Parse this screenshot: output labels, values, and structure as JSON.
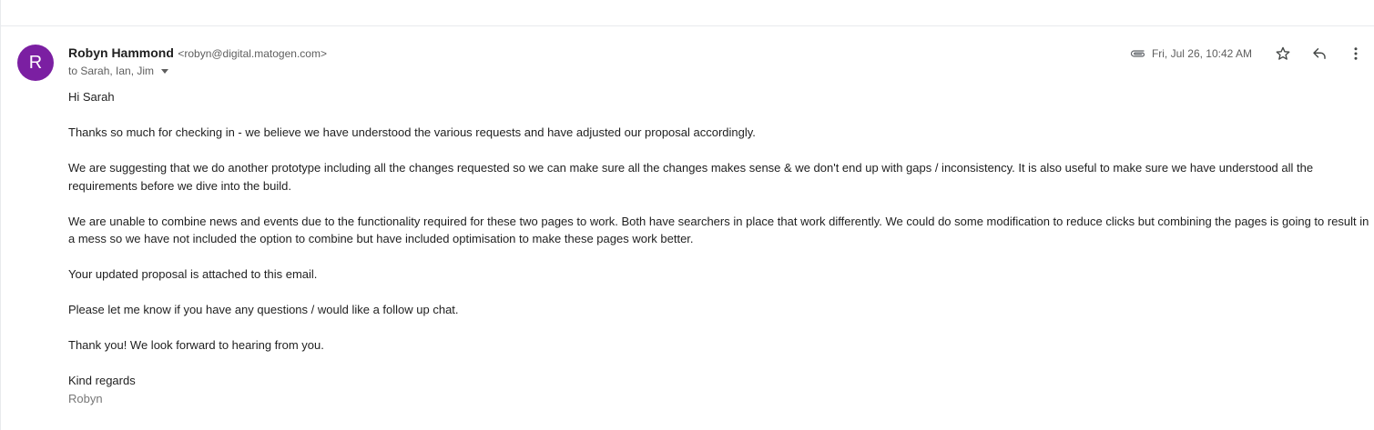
{
  "sender": {
    "avatar_letter": "R",
    "avatar_color": "#7b1fa2",
    "name": "Robyn Hammond",
    "email": "<robyn@digital.matogen.com>"
  },
  "recipients": "to Sarah, Ian, Jim",
  "date": "Fri, Jul 26, 10:42 AM",
  "icons": {
    "attachment": "paperclip-icon",
    "star": "star-icon",
    "reply": "reply-icon",
    "more": "more-vert-icon"
  },
  "body": {
    "greeting": "Hi Sarah",
    "paragraphs": [
      "Thanks so much for checking in - we believe we have understood the various requests and have adjusted our proposal accordingly.",
      "We are suggesting that we do another prototype including all the changes requested so we can make sure all the changes makes sense & we don't end up with gaps / inconsistency.  It is also useful to make sure we have understood all the requirements before we dive into the build.",
      "We are unable to combine news and events due to the functionality required for these two pages to work. Both have searchers in place that work differently. We could do some modification to reduce clicks but combining the pages is going to result in a mess so we have not included the option to combine but have included optimisation to make these pages work better.",
      "Your updated proposal is attached to this email.",
      "Please let me know if you have any questions / would like a follow up chat.",
      "Thank you! We look forward to hearing from you."
    ],
    "closing": "Kind regards",
    "signature": "Robyn"
  }
}
